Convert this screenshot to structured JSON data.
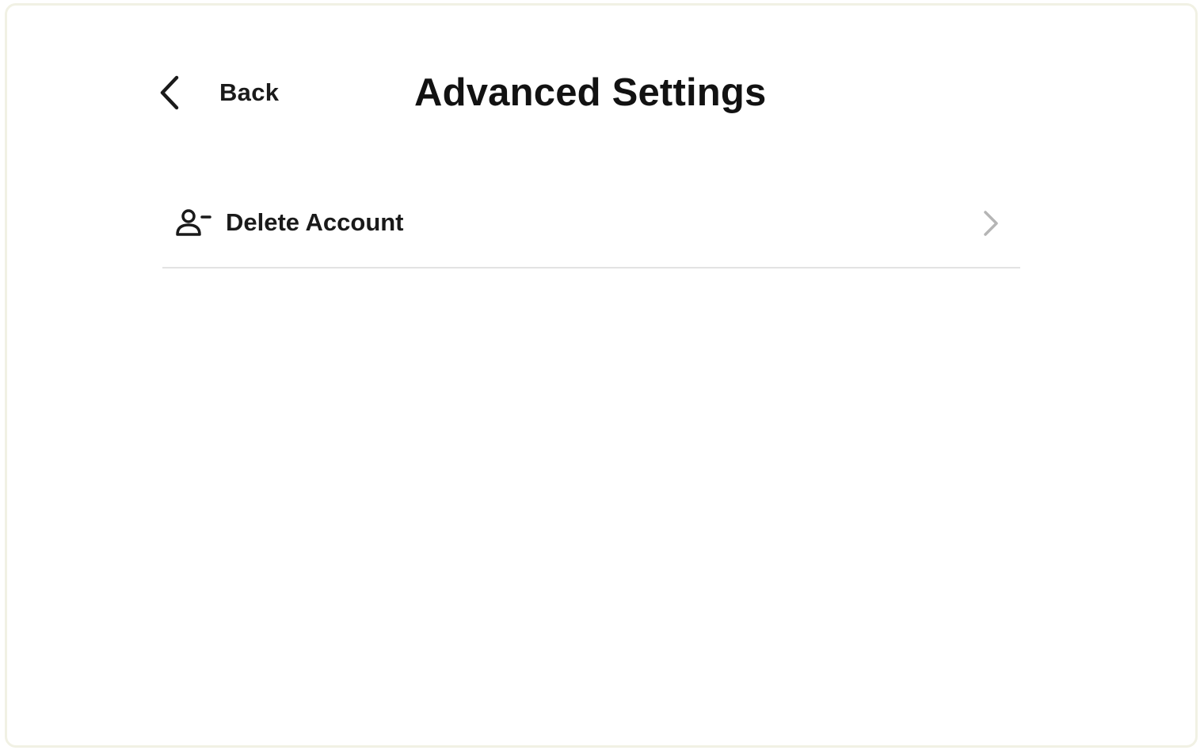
{
  "header": {
    "back_label": "Back",
    "back_icon": "chevron-left-icon",
    "title": "Advanced Settings"
  },
  "settings": {
    "items": [
      {
        "label": "Delete Account",
        "icon": "user-minus-icon",
        "trailing_icon": "chevron-right-icon"
      }
    ]
  },
  "colors": {
    "text": "#1a1a1a",
    "divider": "#e3e3e3",
    "chevron": "#b5b5b5",
    "frame_border": "#f1f1e4"
  }
}
